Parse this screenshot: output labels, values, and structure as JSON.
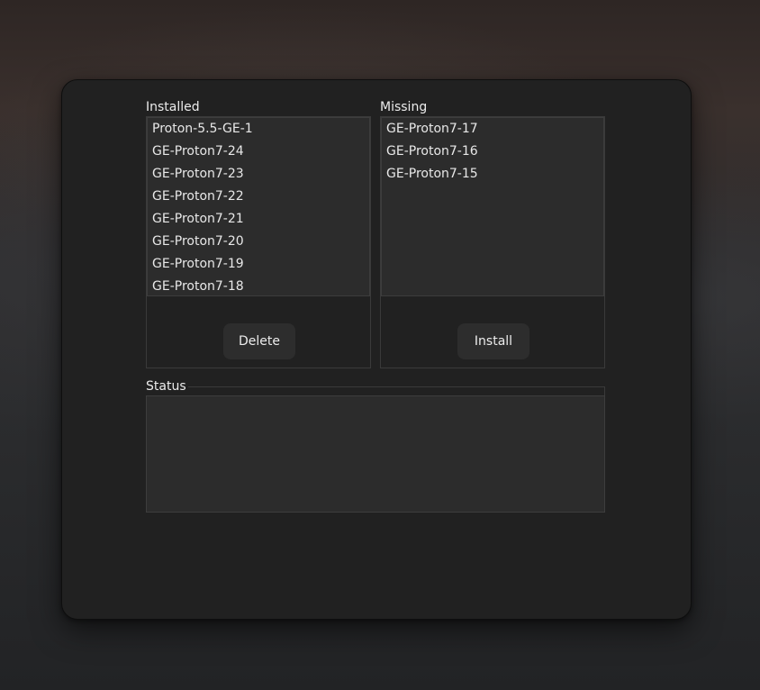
{
  "installed": {
    "label": "Installed",
    "items": [
      "Proton-5.5-GE-1",
      "GE-Proton7-24",
      "GE-Proton7-23",
      "GE-Proton7-22",
      "GE-Proton7-21",
      "GE-Proton7-20",
      "GE-Proton7-19",
      "GE-Proton7-18"
    ],
    "button_label": "Delete"
  },
  "missing": {
    "label": "Missing",
    "items": [
      "GE-Proton7-17",
      "GE-Proton7-16",
      "GE-Proton7-15"
    ],
    "button_label": "Install"
  },
  "status": {
    "label": "Status",
    "text": ""
  }
}
